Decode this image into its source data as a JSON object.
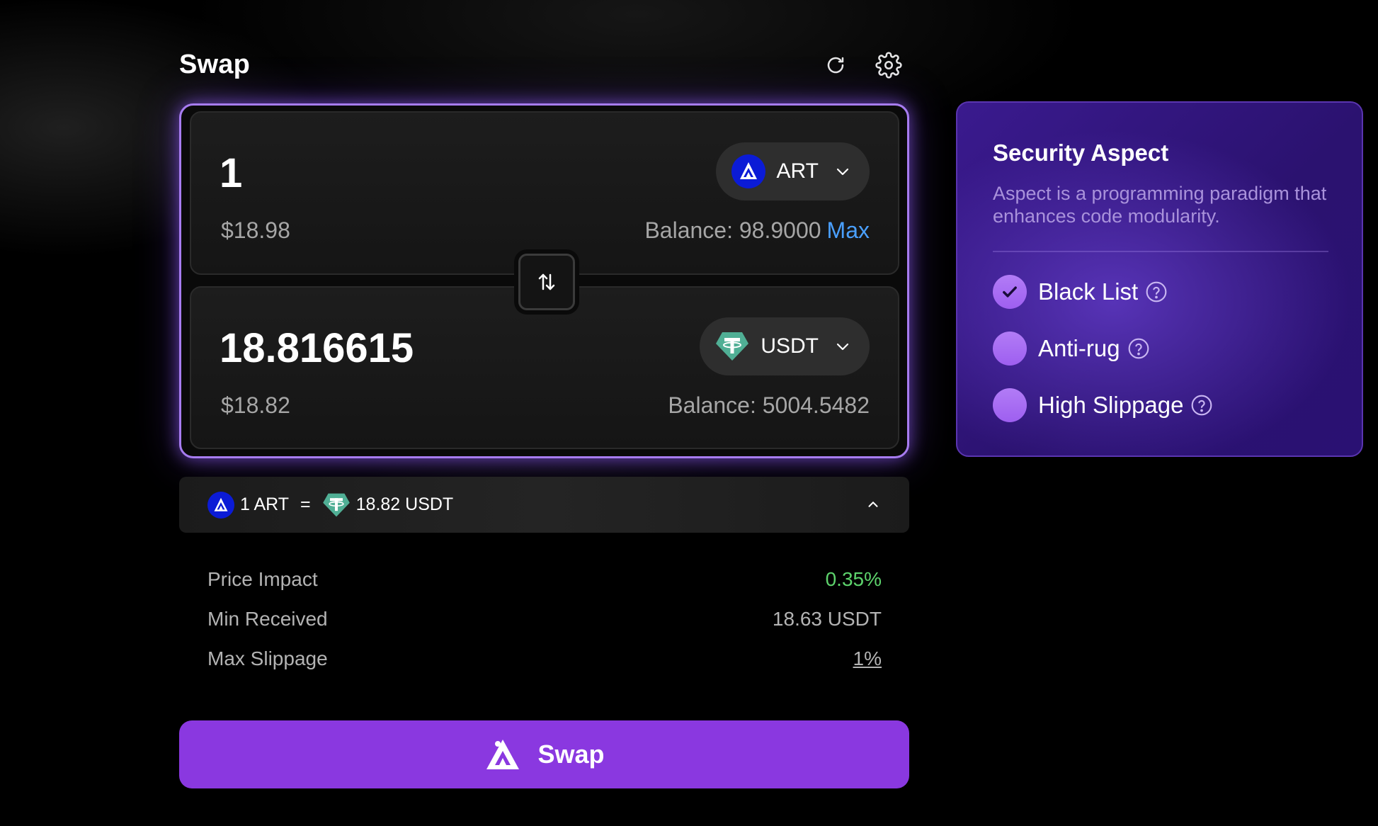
{
  "header": {
    "title": "Swap"
  },
  "from": {
    "amount": "1",
    "usd_value": "$18.98",
    "token": "ART",
    "balance": "Balance: 98.9000",
    "max_label": "Max"
  },
  "to": {
    "amount": "18.816615",
    "usd_value": "$18.82",
    "token": "USDT",
    "balance": "Balance: 5004.5482"
  },
  "rate": {
    "from_text": "1 ART",
    "equals": "=",
    "to_text": "18.82 USDT"
  },
  "details": [
    {
      "label": "Price Impact",
      "value": "0.35%"
    },
    {
      "label": "Min Received",
      "value": "18.63 USDT"
    },
    {
      "label": "Max Slippage",
      "value": "1%"
    }
  ],
  "swap_button": {
    "label": "Swap"
  },
  "security": {
    "title": "Security Aspect",
    "description": "Aspect is a programming paradigm that enhances code modularity.",
    "options": [
      {
        "label": "Black List",
        "checked": true
      },
      {
        "label": "Anti-rug",
        "checked": false
      },
      {
        "label": "High Slippage",
        "checked": false
      }
    ]
  },
  "colors": {
    "accent": "#8a38e0",
    "frame_border": "#a77cf0",
    "max_link": "#4aa0ff",
    "price_impact": "#5dd36c",
    "art_token": "#0b1bd6",
    "usdt_token": "#50af95"
  },
  "icons": {
    "refresh": "refresh-icon",
    "settings": "gear-icon",
    "flip": "swap-arrows-icon",
    "chevron_down": "chevron-down-icon",
    "chevron_up": "chevron-up-icon",
    "art": "art-token-icon",
    "usdt": "usdt-token-icon",
    "help": "help-circle-icon",
    "check": "check-icon"
  }
}
